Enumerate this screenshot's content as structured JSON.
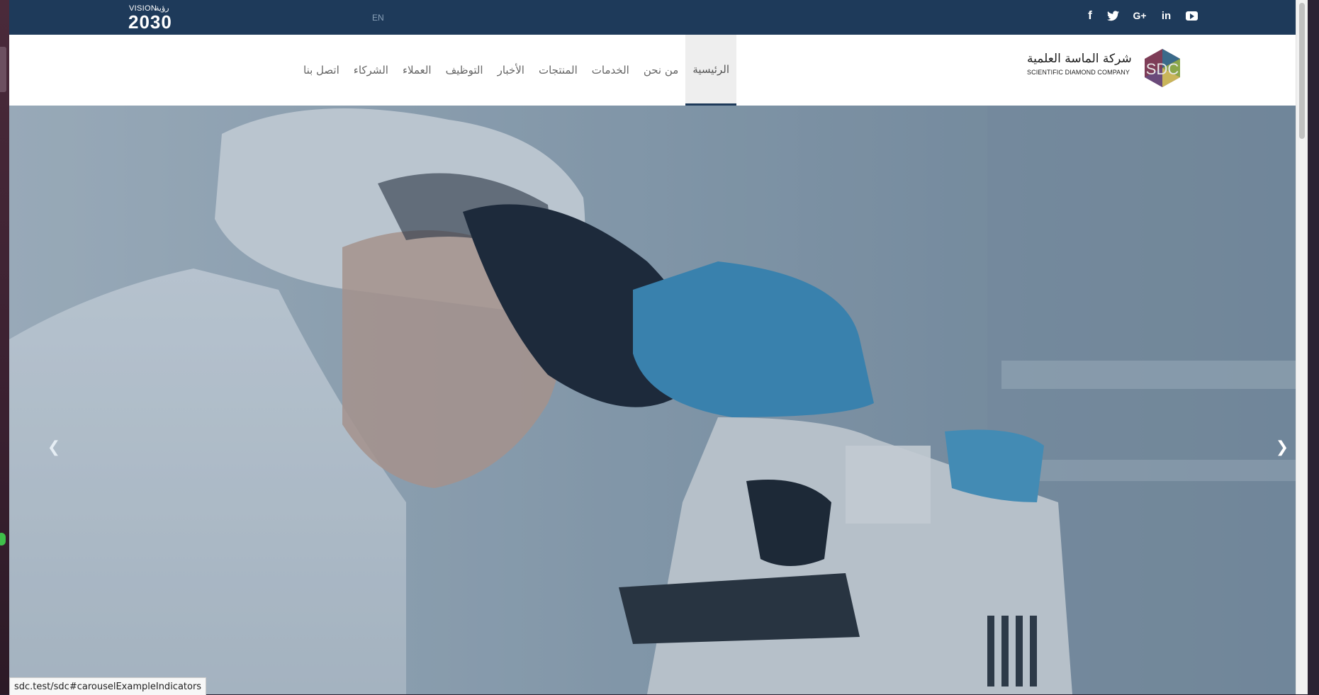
{
  "topbar": {
    "vision": {
      "word": "VISION",
      "arabic": "رؤية",
      "year": "2030"
    },
    "language": "EN",
    "social": [
      "facebook-icon",
      "twitter-icon",
      "google-plus-icon",
      "linkedin-icon",
      "youtube-icon"
    ],
    "social_glyphs": {
      "facebook": "f",
      "google_plus": "G+",
      "linkedin": "in"
    }
  },
  "logo": {
    "arabic": "شركة الماسة العلمية",
    "english": "SCIENTIFIC DIAMOND COMPANY",
    "mark": "SDC"
  },
  "nav": {
    "items": [
      {
        "label": "الرئيسية",
        "active": true
      },
      {
        "label": "من نحن"
      },
      {
        "label": "الخدمات"
      },
      {
        "label": "المنتجات"
      },
      {
        "label": "الأخبار"
      },
      {
        "label": "التوظيف"
      },
      {
        "label": "العملاء"
      },
      {
        "label": "الشركاء"
      },
      {
        "label": "اتصل بنا"
      }
    ]
  },
  "carousel": {
    "prev_glyph": "❮",
    "next_glyph": "❯",
    "slide_description_icon": "microscope-scientist-photo"
  },
  "status_url": "sdc.test/sdc#carouselExampleIndicators",
  "colors": {
    "topbar": "#1e3a5a",
    "active_bg": "#eeeeee",
    "nav_text": "#666666"
  }
}
